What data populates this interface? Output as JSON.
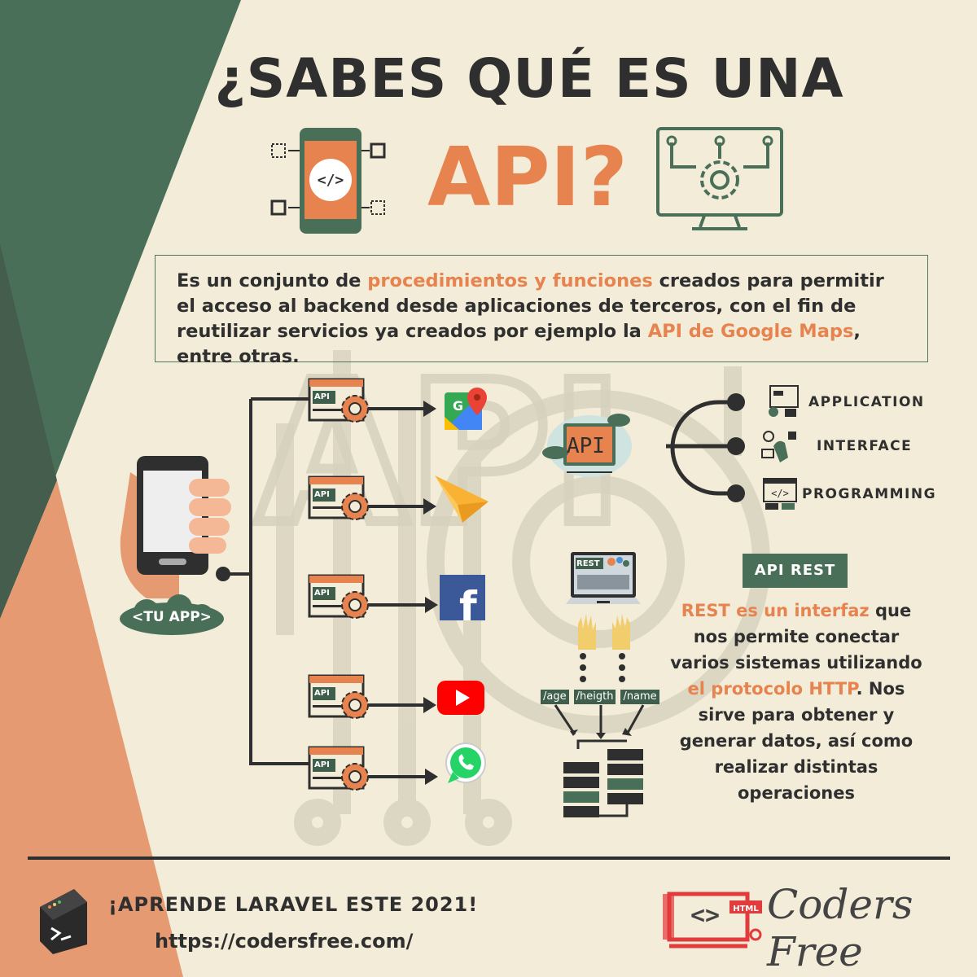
{
  "header": {
    "title": "¿SABES QUÉ ES UNA",
    "api_word": "API?"
  },
  "definition": {
    "part1": "Es un conjunto de ",
    "highlight1": "procedimientos  y funciones",
    "part2": " creados  para permitir el acceso al backend desde aplicaciones de terceros, con el fin de reutilizar servicios ya creados por ejemplo la ",
    "highlight2": "API de Google Maps",
    "part3": ", entre otras."
  },
  "acronym": {
    "application": "APPLICATION",
    "interface": "INTERFACE",
    "programming": "PROGRAMMING",
    "cloud_label": "API"
  },
  "app": {
    "tu_app": "<TU APP>",
    "api_tag": "API"
  },
  "rest": {
    "badge": "API REST",
    "laptop_label": "REST",
    "endpoints": [
      "/age",
      "/heigth",
      "/name"
    ],
    "desc_hl1": "REST es un interfaz",
    "desc_p1": " que nos permite  conectar varios sistemas utilizando ",
    "desc_hl2": "el protocolo HTTP",
    "desc_p2": ". Nos sirve para obtener y generar datos, así como realizar distintas operaciones"
  },
  "footer": {
    "cta": "¡APRENDE LARAVEL ESTE 2021!",
    "url": "https://codersfree.com/",
    "brand": "Coders Free",
    "logo_tag": "HTML"
  },
  "colors": {
    "green": "#4a6f58",
    "orange": "#e6834f",
    "cream": "#f3ecd8",
    "dark": "#2f2f2f"
  }
}
